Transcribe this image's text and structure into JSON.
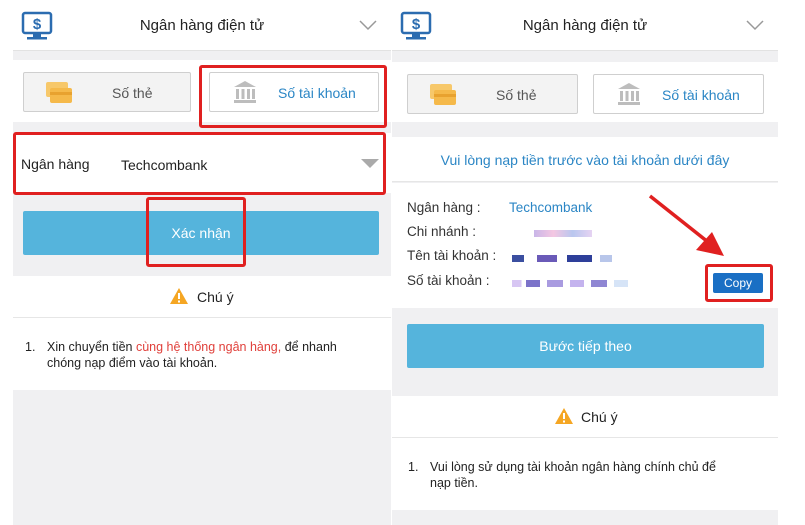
{
  "left": {
    "header": {
      "title": "Ngân hàng điện tử"
    },
    "tabs": [
      {
        "label": "Số thẻ",
        "icon": "card-icon",
        "active": false
      },
      {
        "label": "Số tài khoản",
        "icon": "bank-building-icon",
        "active": true
      }
    ],
    "bank_field": {
      "label": "Ngân hàng",
      "value": "Techcombank"
    },
    "confirm_button": "Xác nhận",
    "notice": {
      "title": "Chú ý",
      "number": "1.",
      "line1_prefix": "Xin chuyển tiền ",
      "line1_highlight": "cùng hệ thống ngân hàng,",
      "line1_suffix": " để nhanh",
      "line2": "chóng nạp điểm vào tài khoản."
    }
  },
  "right": {
    "header": {
      "title": "Ngân hàng điện tử"
    },
    "tabs": [
      {
        "label": "Số thẻ",
        "icon": "card-icon",
        "active": false
      },
      {
        "label": "Số tài khoản",
        "icon": "bank-building-icon",
        "active": true
      }
    ],
    "instruction": "Vui lòng nạp tiền trước vào tài khoản dưới đây",
    "info": {
      "bank_label": "Ngân hàng :",
      "bank_value": "Techcombank",
      "branch_label": "Chi nhánh :",
      "account_name_label": "Tên tài khoản :",
      "account_number_label": "Số tài khoản :"
    },
    "copy_button": "Copy",
    "next_button": "Bước tiếp theo",
    "notice": {
      "title": "Chú ý",
      "number": "1.",
      "line1": "Vui lòng sử dụng tài khoản ngân hàng chính chủ để",
      "line2": "nạp tiền."
    }
  },
  "colors": {
    "accent_blue": "#55b4dc",
    "link_blue": "#2b86c5",
    "copy_blue": "#1a6fc4",
    "highlight_red": "#e02020",
    "warning_orange": "#f5a623"
  }
}
